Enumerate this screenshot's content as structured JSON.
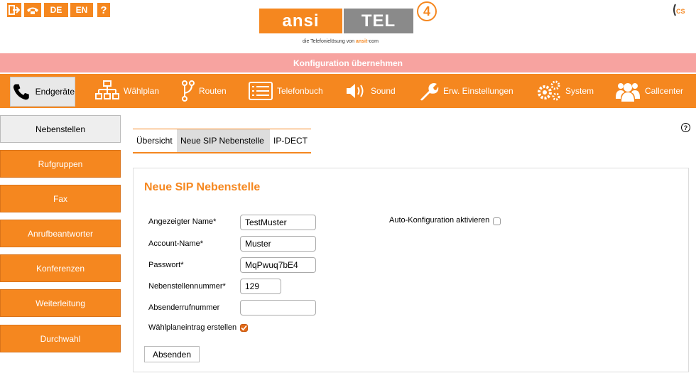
{
  "topbar": {
    "lang_de": "DE",
    "lang_en": "EN",
    "help": "?",
    "cs_label": "CS"
  },
  "logo": {
    "part1": "ansi",
    "part2": "TEL",
    "version": "4",
    "tagline_prefix": "die Telefonielösung von",
    "tagline_brand": "ansit",
    "tagline_suffix": "-com"
  },
  "banner": {
    "label": "Konfiguration übernehmen"
  },
  "nav": {
    "items": [
      {
        "label": "Endgeräte",
        "icon": "phone-icon"
      },
      {
        "label": "Wählplan",
        "icon": "sitemap-icon"
      },
      {
        "label": "Routen",
        "icon": "route-icon"
      },
      {
        "label": "Telefonbuch",
        "icon": "phonebook-icon"
      },
      {
        "label": "Sound",
        "icon": "speaker-icon"
      },
      {
        "label": "Erw. Einstellungen",
        "icon": "wrench-icon"
      },
      {
        "label": "System",
        "icon": "gears-icon"
      },
      {
        "label": "Callcenter",
        "icon": "users-icon"
      }
    ],
    "active_index": 0
  },
  "sidebar": {
    "items": [
      {
        "label": "Nebenstellen"
      },
      {
        "label": "Rufgruppen"
      },
      {
        "label": "Fax"
      },
      {
        "label": "Anrufbeantworter"
      },
      {
        "label": "Konferenzen"
      },
      {
        "label": "Weiterleitung"
      },
      {
        "label": "Durchwahl"
      }
    ],
    "active_index": 0
  },
  "help_icon": "?",
  "subtabs": {
    "items": [
      {
        "label": "Übersicht"
      },
      {
        "label": "Neue SIP Nebenstelle"
      },
      {
        "label": "IP-DECT"
      }
    ],
    "active_index": 1
  },
  "form": {
    "title": "Neue SIP Nebenstelle",
    "fields": {
      "display_name": {
        "label": "Angezeigter Name*",
        "value": "TestMuster"
      },
      "account_name": {
        "label": "Account-Name*",
        "value": "Muster"
      },
      "password": {
        "label": "Passwort*",
        "value": "MqPwuq7bE4"
      },
      "extension": {
        "label": "Nebenstellennummer*",
        "value": "129"
      },
      "sender_number": {
        "label": "Absenderrufnummer",
        "value": ""
      }
    },
    "dialplan_entry": {
      "label": "Wählplaneintrag erstellen",
      "checked": true
    },
    "auto_config": {
      "label": "Auto-Konfiguration aktivieren",
      "checked": false
    },
    "submit_label": "Absenden"
  },
  "colors": {
    "accent": "#f5871f",
    "banner": "#f7a3a0",
    "logo_grey": "#8a8a8a"
  }
}
